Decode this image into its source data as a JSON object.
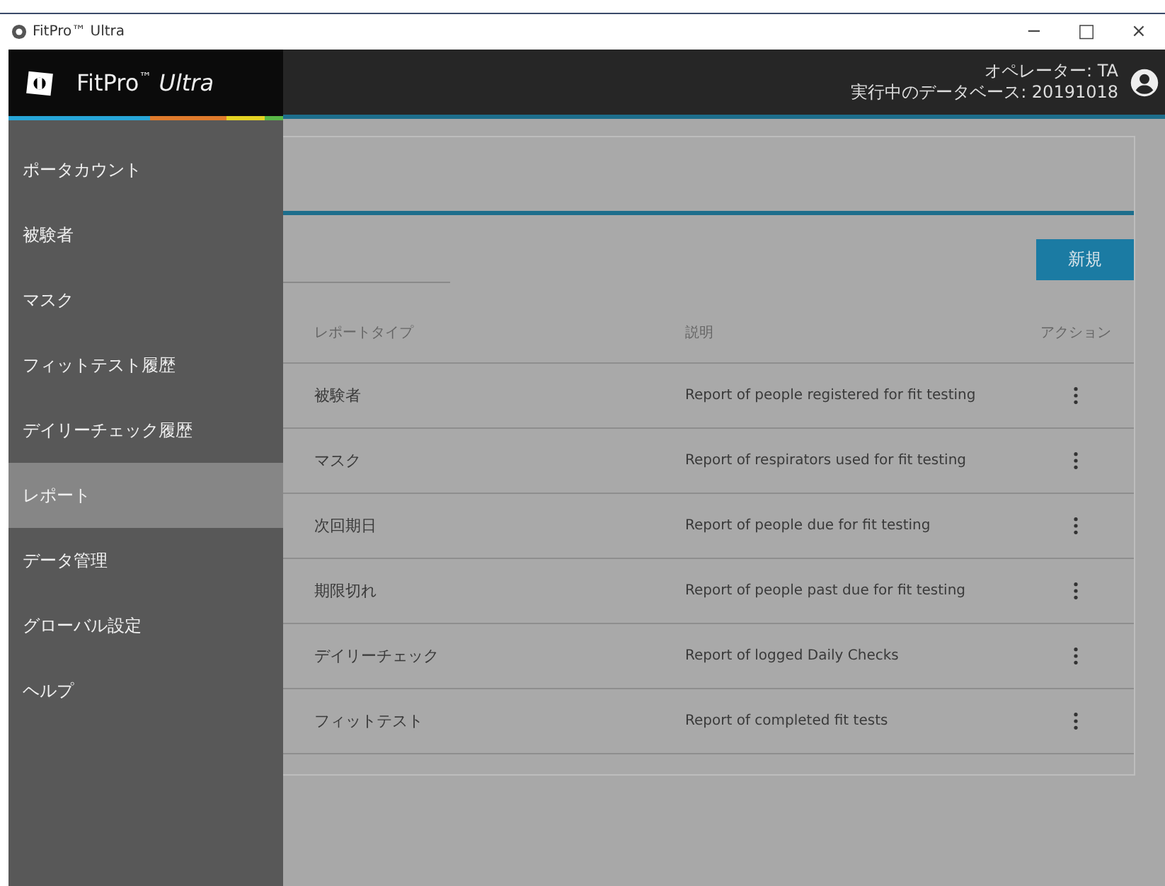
{
  "window": {
    "title": "FitPro™ Ultra",
    "controls": [
      "−",
      "□",
      "×"
    ]
  },
  "header": {
    "logo": "FitPro$^{™}$ *Ultra*",
    "operator": "オペレーター: TA",
    "database": "実行中のデータベース: 20191018"
  },
  "sidebar": {
    "items": [
      {
        "label": "ポータカウント",
        "selected": false
      },
      {
        "label": "被験者",
        "selected": false
      },
      {
        "label": "マスク",
        "selected": false
      },
      {
        "label": "フィットテスト履歴",
        "selected": false
      },
      {
        "label": "デイリーチェック履歴",
        "selected": false
      },
      {
        "label": "レポート",
        "selected": true
      },
      {
        "label": "データ管理",
        "selected": false
      },
      {
        "label": "グローバル設定",
        "selected": false
      },
      {
        "label": "ヘルプ",
        "selected": false
      }
    ]
  },
  "new_button": "新規",
  "table": {
    "columns": [
      "レポートタイプ",
      "説明",
      "アクション"
    ],
    "rows": [
      {
        "type": "被験者",
        "description": "Report of people registered for fit testing"
      },
      {
        "type": "マスク",
        "description": "Report of respirators used for fit testing"
      },
      {
        "type": "次回期日",
        "description": "Report of people due for fit testing"
      },
      {
        "type": "期限切れ",
        "description": "Report of people past due for fit testing"
      },
      {
        "type": "デイリーチェック",
        "description": "Report of logged Daily Checks"
      },
      {
        "type": "フィットテスト",
        "description": "Report of completed fit tests"
      }
    ]
  }
}
